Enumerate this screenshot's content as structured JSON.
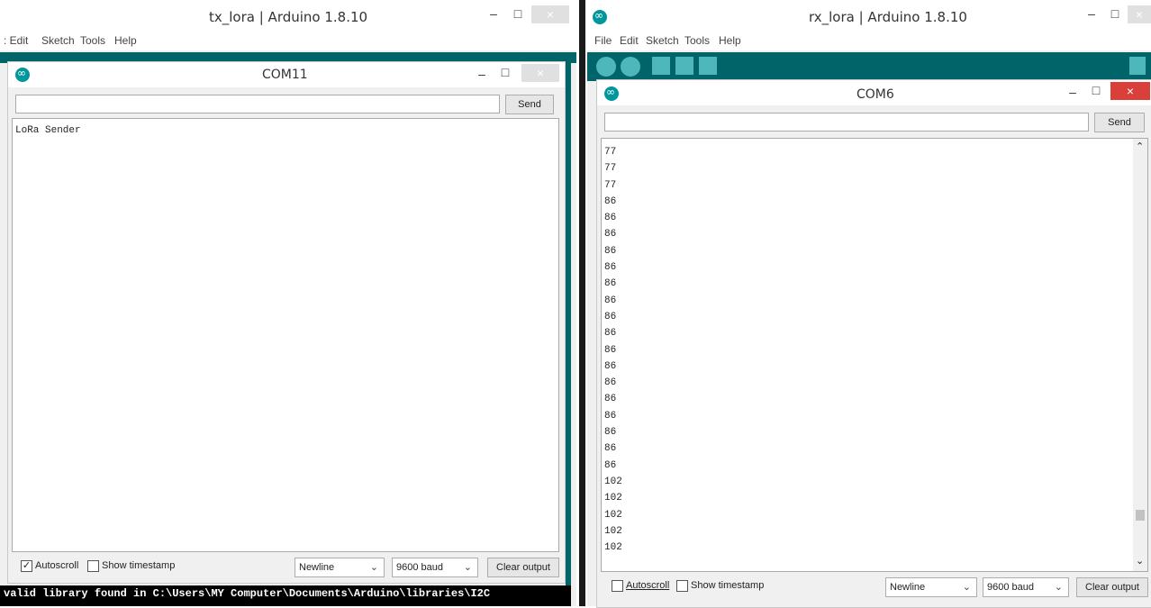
{
  "left_ide": {
    "title": "tx_lora | Arduino 1.8.10",
    "menu": [
      ": Edit",
      "Sketch",
      "Tools",
      "Help"
    ],
    "serial": {
      "title": "COM11",
      "send_label": "Send",
      "input_value": "",
      "output_lines": [
        "LoRa Sender"
      ],
      "autoscroll_label": "Autoscroll",
      "autoscroll_checked": true,
      "timestamp_label": "Show timestamp",
      "timestamp_checked": false,
      "line_ending": "Newline",
      "baud": "9600 baud",
      "clear_label": "Clear output"
    },
    "console_text": "valid library found in C:\\Users\\MY Computer\\Documents\\Arduino\\libraries\\I2C"
  },
  "right_ide": {
    "title": "rx_lora | Arduino 1.8.10",
    "menu": [
      "File",
      "Edit",
      "Sketch",
      "Tools",
      "Help"
    ],
    "serial": {
      "title": "COM6",
      "send_label": "Send",
      "input_value": "",
      "output_lines": [
        "77",
        "77",
        "77",
        "86",
        "86",
        "86",
        "86",
        "86",
        "86",
        "86",
        "86",
        "86",
        "86",
        "86",
        "86",
        "86",
        "86",
        "86",
        "86",
        "86",
        "102",
        "102",
        "102",
        "102",
        "102"
      ],
      "autoscroll_label": "Autoscroll",
      "autoscroll_checked": false,
      "timestamp_label": "Show timestamp",
      "timestamp_checked": false,
      "line_ending": "Newline",
      "baud": "9600 baud",
      "clear_label": "Clear output"
    }
  },
  "icons": {
    "close": "×",
    "minimize": "–",
    "maximize": "□",
    "chevron": "⌄",
    "check": "✓",
    "scroll_up": "⌃",
    "scroll_down": "⌄"
  },
  "colors": {
    "arduino_teal": "#006468",
    "toolbar_button": "#4db7bb",
    "close_red": "#d9403a"
  }
}
